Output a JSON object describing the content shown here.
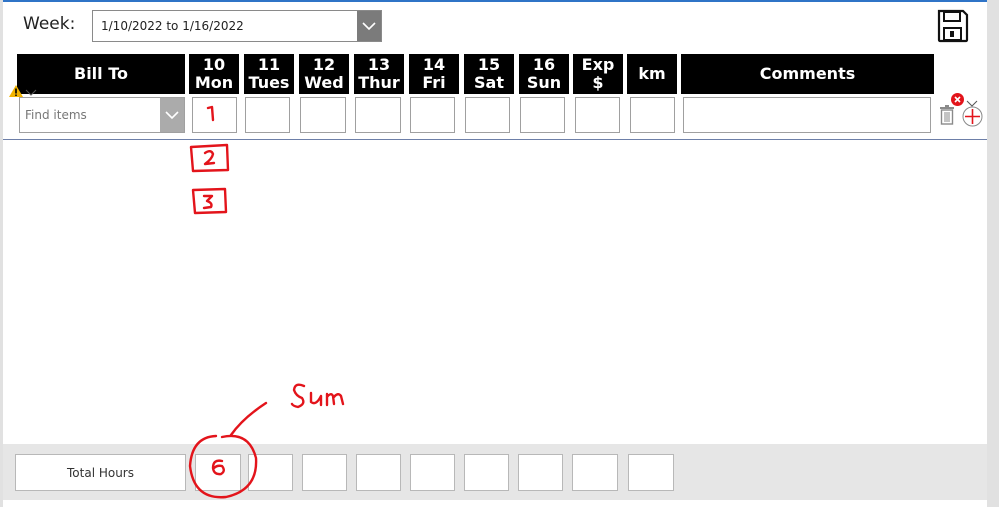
{
  "header": {
    "week_label": "Week:",
    "week_value": "1/10/2022 to 1/16/2022"
  },
  "columns": [
    {
      "line1": "Bill To",
      "line2": ""
    },
    {
      "line1": "10",
      "line2": "Mon"
    },
    {
      "line1": "11",
      "line2": "Tues"
    },
    {
      "line1": "12",
      "line2": "Wed"
    },
    {
      "line1": "13",
      "line2": "Thur"
    },
    {
      "line1": "14",
      "line2": "Fri"
    },
    {
      "line1": "15",
      "line2": "Sat"
    },
    {
      "line1": "16",
      "line2": "Sun"
    },
    {
      "line1": "Exp",
      "line2": "$"
    },
    {
      "line1": "km",
      "line2": ""
    },
    {
      "line1": "Comments",
      "line2": ""
    }
  ],
  "entry_row": {
    "bill_to_placeholder": "Find items",
    "values": [
      "",
      "",
      "",
      "",
      "",
      "",
      "",
      "",
      "",
      ""
    ]
  },
  "footer": {
    "total_label": "Total Hours",
    "totals": [
      "",
      "",
      "",
      "",
      "",
      "",
      "",
      "",
      ""
    ]
  },
  "annotations": {
    "handwritten_mon_values": [
      "1",
      "2",
      "3"
    ],
    "handwritten_total": "6",
    "handwritten_note": "Sum",
    "ink_color": "#e3141b"
  },
  "colors": {
    "header_bg": "#000000",
    "accent_top_border": "#2f74c7",
    "error": "#e3141b",
    "warning": "#f2b400"
  }
}
